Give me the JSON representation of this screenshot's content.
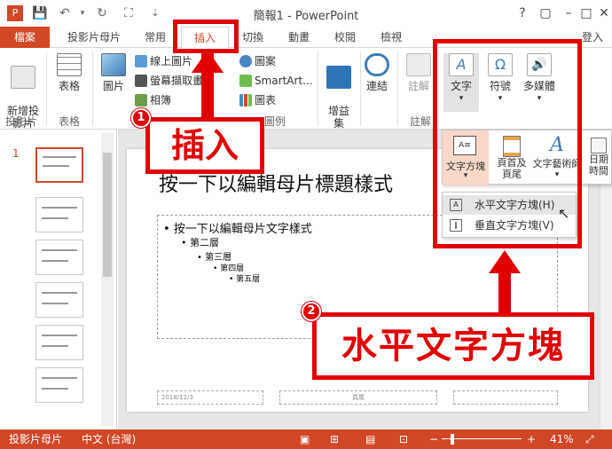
{
  "titlebar": {
    "title": "簡報1 - PowerPoint",
    "window_buttons": [
      "?",
      "▢",
      "–",
      "□",
      "✕"
    ]
  },
  "tabs": [
    {
      "id": "file",
      "label": "檔案"
    },
    {
      "id": "slideshow",
      "label": "投影片母片"
    },
    {
      "id": "home",
      "label": "常用"
    },
    {
      "id": "insert",
      "label": "插入"
    },
    {
      "id": "switch",
      "label": "切換"
    },
    {
      "id": "anim",
      "label": "動畫"
    },
    {
      "id": "review",
      "label": "校閱"
    },
    {
      "id": "view",
      "label": "檢視"
    }
  ],
  "login_label": "登入",
  "ribbon": {
    "new_slide": "新增投\n影片",
    "table": "表格",
    "picture": "圖片",
    "online_picture": "線上圖片",
    "screenshot": "螢幕擷取畫面",
    "album": "相簿",
    "shapes": "圖案",
    "smartart": "SmartArt...",
    "chart": "圖表",
    "addins": "增益\n集",
    "link": "連結",
    "comment": "註解",
    "text": "文字",
    "symbol": "符號",
    "media": "多媒體",
    "groups": {
      "slides": "投影片",
      "tables": "表格",
      "illustrations": "圖例",
      "comments": "註解"
    }
  },
  "gallery": {
    "textbox": "文字方塊",
    "header_footer": "頁首及\n頁尾",
    "wordart": "文字藝術師",
    "datetime": "日期\n時間"
  },
  "textbox_menu": {
    "horizontal": "水平文字方塊(H)",
    "vertical": "垂直文字方塊(V)"
  },
  "slide": {
    "number": "1",
    "title": "按一下以編輯母片標題樣式",
    "bullets": [
      "• 按一下以編輯母片文字樣式",
      "• 第二層",
      "• 第三層",
      "• 第四層",
      "• 第五層"
    ],
    "footer_date": "2018/12/3",
    "footer_center": "頁尾"
  },
  "status": {
    "view_label": "投影片母片",
    "language": "中文 (台灣)",
    "zoom": "41%"
  },
  "annotations": {
    "step1_num": "1",
    "step1_label": "插入",
    "step2_num": "2",
    "step2_label": "水平文字方塊"
  },
  "colors": {
    "accent": "#d24726",
    "annotation": "#e00000"
  }
}
